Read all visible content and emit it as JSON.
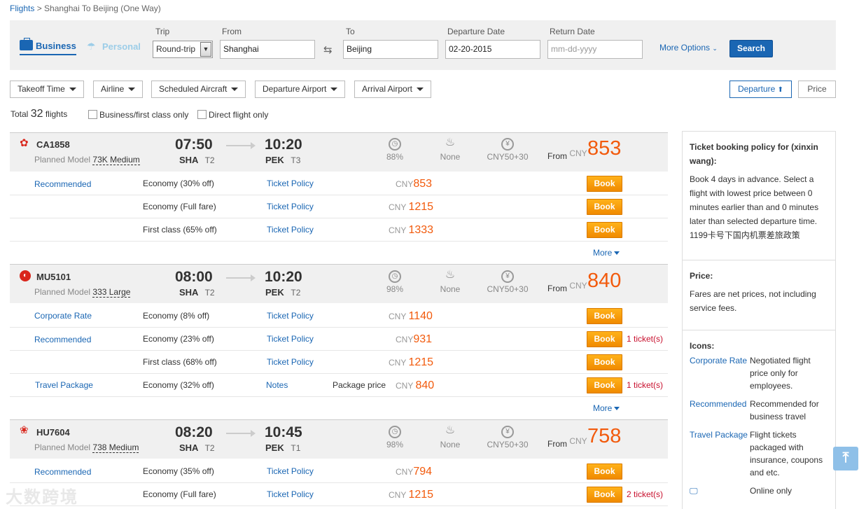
{
  "breadcrumb": {
    "link": "Flights",
    "sep": ">",
    "current": "Shanghai To Beijing (One Way)"
  },
  "search": {
    "business": "Business",
    "personal": "Personal",
    "trip_label": "Trip",
    "trip_value": "Round-trip",
    "from_label": "From",
    "from_value": "Shanghai",
    "to_label": "To",
    "to_value": "Beijing",
    "depart_label": "Departure Date",
    "depart_value": "02-20-2015",
    "return_label": "Return Date",
    "return_placeholder": "mm-dd-yyyy",
    "more_options": "More Options",
    "search_btn": "Search"
  },
  "filters": [
    "Takeoff Time",
    "Airline",
    "Scheduled Aircraft",
    "Departure Airport",
    "Arrival Airport"
  ],
  "sort": {
    "departure": "Departure",
    "price": "Price"
  },
  "summary": {
    "total_label": "Total",
    "total_count": "32",
    "flights_label": "flights",
    "business_only": "Business/first class only",
    "direct_only": "Direct flight only"
  },
  "flights": [
    {
      "no": "CA1858",
      "model_label": "Planned Model",
      "model": "73K Medium",
      "dep_time": "07:50",
      "dep_apt": "SHA",
      "dep_term": "T2",
      "arr_time": "10:20",
      "arr_apt": "PEK",
      "arr_term": "T3",
      "ontime": "88%",
      "meal": "None",
      "tax": "CNY50+30",
      "from": "From",
      "cur": "CNY",
      "price": "853",
      "fares": [
        {
          "tag": "Recommended",
          "cabin": "Economy  (30% off)",
          "policy": "Ticket Policy",
          "note": "",
          "cur": "CNY",
          "price": "853",
          "book": "Book",
          "tickets": ""
        },
        {
          "tag": "",
          "cabin": "Economy   (Full fare)",
          "policy": "Ticket Policy",
          "note": "",
          "cur": "CNY",
          "price": "1215",
          "book": "Book",
          "tickets": ""
        },
        {
          "tag": "",
          "cabin": "First class  (65% off)",
          "policy": "Ticket Policy",
          "note": "",
          "cur": "CNY",
          "price": "1333",
          "book": "Book",
          "tickets": ""
        }
      ],
      "more": "More"
    },
    {
      "no": "MU5101",
      "model_label": "Planned Model",
      "model": "333 Large",
      "dep_time": "08:00",
      "dep_apt": "SHA",
      "dep_term": "T2",
      "arr_time": "10:20",
      "arr_apt": "PEK",
      "arr_term": "T2",
      "ontime": "98%",
      "meal": "None",
      "tax": "CNY50+30",
      "from": "From",
      "cur": "CNY",
      "price": "840",
      "fares": [
        {
          "tag": "Corporate Rate",
          "cabin": "Economy    (8% off)",
          "policy": "Ticket Policy",
          "note": "",
          "cur": "CNY",
          "price": "1140",
          "book": "Book",
          "tickets": ""
        },
        {
          "tag": "Recommended",
          "cabin": "Economy  (23% off)",
          "policy": "Ticket Policy",
          "note": "",
          "cur": "CNY",
          "price": "931",
          "book": "Book",
          "tickets": "1 ticket(s)"
        },
        {
          "tag": "",
          "cabin": "First class  (68% off)",
          "policy": "Ticket Policy",
          "note": "",
          "cur": "CNY",
          "price": "1215",
          "book": "Book",
          "tickets": ""
        },
        {
          "tag": "Travel Package",
          "cabin": "Economy  (32% off)",
          "policy": "Notes",
          "note": "Package price",
          "cur": "CNY",
          "price": "840",
          "book": "Book",
          "tickets": "1 ticket(s)"
        }
      ],
      "more": "More"
    },
    {
      "no": "HU7604",
      "model_label": "Planned Model",
      "model": "738 Medium",
      "dep_time": "08:20",
      "dep_apt": "SHA",
      "dep_term": "T2",
      "arr_time": "10:45",
      "arr_apt": "PEK",
      "arr_term": "T1",
      "ontime": "98%",
      "meal": "None",
      "tax": "CNY50+30",
      "from": "From",
      "cur": "CNY",
      "price": "758",
      "fares": [
        {
          "tag": "Recommended",
          "cabin": "Economy  (35% off)",
          "policy": "Ticket Policy",
          "note": "",
          "cur": "CNY",
          "price": "794",
          "book": "Book",
          "tickets": ""
        },
        {
          "tag": "",
          "cabin": "Economy   (Full fare)",
          "policy": "Ticket Policy",
          "note": "",
          "cur": "CNY",
          "price": "1215",
          "book": "Book",
          "tickets": "2 ticket(s)"
        }
      ],
      "more": ""
    }
  ],
  "sidebar": {
    "policy_title": "Ticket booking policy for (xinxin wang):",
    "policy_text": "Book 4 days in advance. Select a flight with lowest price between 0 minutes earlier than and 0 minutes later than selected departure time.",
    "policy_cn": "1199卡号下国内机票差旅政策",
    "price_title": "Price:",
    "price_text": "Fares are net prices, not including service fees.",
    "icons_title": "Icons:",
    "icons": [
      {
        "k": "Corporate Rate",
        "v": "Negotiated flight price only for employees."
      },
      {
        "k": "Recommended",
        "v": "Recommended for business travel"
      },
      {
        "k": "Travel Package",
        "v": "Flight tickets packaged with insurance, coupons and etc."
      },
      {
        "k": "",
        "v": "Online only"
      }
    ]
  },
  "watermark": "大数跨境",
  "colors": {
    "accent": "#1a66b3",
    "price": "#f25a0c",
    "book": "#f39c0a"
  }
}
